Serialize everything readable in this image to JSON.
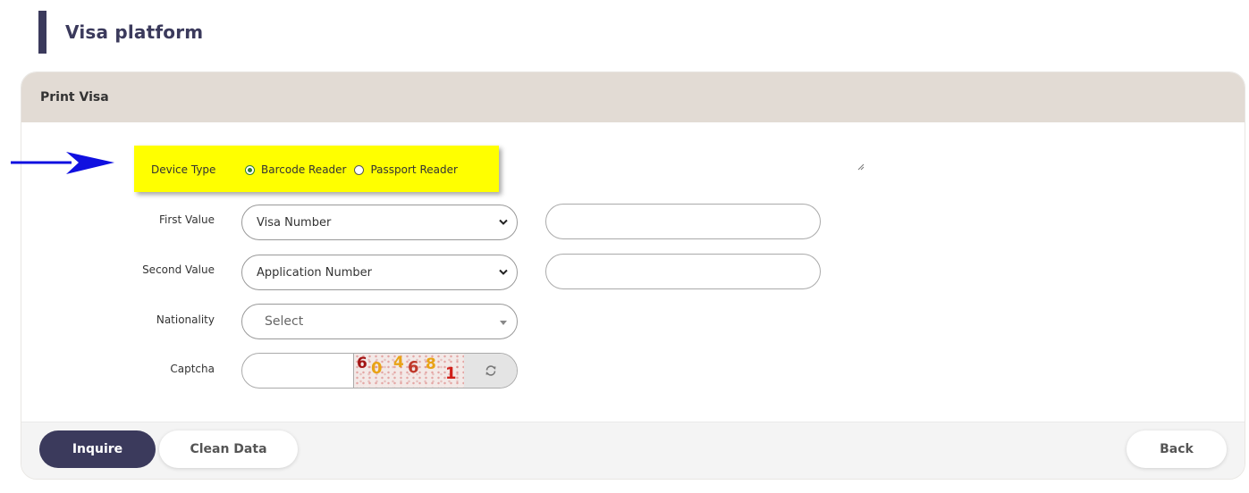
{
  "page": {
    "title": "Visa platform"
  },
  "card": {
    "title": "Print Visa"
  },
  "device_type": {
    "label": "Device Type",
    "options": [
      {
        "label": "Barcode Reader",
        "selected": true
      },
      {
        "label": "Passport Reader",
        "selected": false
      }
    ]
  },
  "first_value": {
    "label": "First Value",
    "select_value": "Visa Number",
    "input_value": ""
  },
  "second_value": {
    "label": "Second Value",
    "select_value": "Application Number",
    "input_value": ""
  },
  "nationality": {
    "label": "Nationality",
    "placeholder": "Select"
  },
  "captcha": {
    "label": "Captcha",
    "input_value": "",
    "digits": [
      {
        "char": "6",
        "color": "#a31515"
      },
      {
        "char": "0",
        "color": "#e8a317"
      },
      {
        "char": "4",
        "color": "#e8a317"
      },
      {
        "char": "6",
        "color": "#c0392b"
      },
      {
        "char": "8",
        "color": "#e8a317"
      },
      {
        "char": "1",
        "color": "#d0201a"
      }
    ],
    "refresh_icon": "refresh-icon"
  },
  "buttons": {
    "inquire": "Inquire",
    "clean": "Clean Data",
    "back": "Back"
  },
  "colors": {
    "primary": "#3b3a5c",
    "card_header": "#e2dbd4",
    "highlight": "#ffff00",
    "arrow": "#1010e0",
    "radio_checked": "#2e7d32"
  }
}
